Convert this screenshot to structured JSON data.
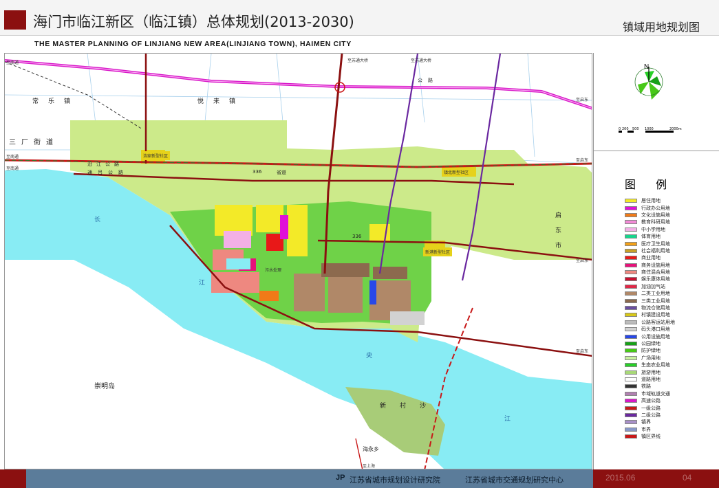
{
  "header": {
    "title": "海门市临江新区（临江镇）总体规划(2013-2030)",
    "sheet_title": "镇域用地规划图",
    "subtitle": "THE  MASTER  PLANNING OF  LINJIANG  NEW  AREA(LINJIANG  TOWN),  HAIMEN CITY"
  },
  "map": {
    "compass_north": "N",
    "scale_labels": [
      "0",
      "200",
      "500",
      "1000",
      "2000m"
    ],
    "places": {
      "changle": "常乐镇",
      "yuelai": "悦来镇",
      "sanchang": "三厂街道",
      "qidong": "启东市",
      "chongming": "崇明岛",
      "haiyong": "海永乡",
      "xincunsha": "新村沙"
    },
    "water": {
      "chang": "长",
      "jiang1": "江",
      "yang": "央",
      "jiang2": "江"
    },
    "roads": {
      "shengdao336": "336",
      "shengdao_label": "省道",
      "yanjiang": "沿江公路",
      "gonglu": "公路",
      "tonglu": "通吕公路"
    },
    "communities": {
      "haojia": "浩家新型社区",
      "qiaoqian": "镇北新型社区",
      "xincheng": "新港新型社区"
    },
    "small_text": {
      "west_edge1": "至南通",
      "west_edge2": "至南通",
      "west_edge3": "至南通",
      "east_edge1": "至启东",
      "east_edge2": "至启东",
      "east_edge3": "至启东",
      "east_edge4": "至启东",
      "north1": "至苏通大桥",
      "north2": "至苏通大桥",
      "hub": "污水处理",
      "south": "至上海"
    }
  },
  "legend": {
    "title": "图 例",
    "items": [
      {
        "label": "居住用地",
        "color": "#f3ea28"
      },
      {
        "label": "行政办公用地",
        "color": "#e010d8"
      },
      {
        "label": "文化设施用地",
        "color": "#f07a18"
      },
      {
        "label": "教育科研用地",
        "color": "#f28ad6"
      },
      {
        "label": "中小学用地",
        "color": "#f3b0e6"
      },
      {
        "label": "体育用地",
        "color": "#18d48c"
      },
      {
        "label": "医疗卫生用地",
        "color": "#f2a018"
      },
      {
        "label": "社会福利用地",
        "color": "#c8a028"
      },
      {
        "label": "商业用地",
        "color": "#e81818"
      },
      {
        "label": "商务设施用地",
        "color": "#e8107a"
      },
      {
        "label": "商住混合用地",
        "color": "#ee8880"
      },
      {
        "label": "娱乐康体用地",
        "color": "#c81030"
      },
      {
        "label": "加油加气站",
        "color": "#e02848"
      },
      {
        "label": "二类工业用地",
        "color": "#b08868"
      },
      {
        "label": "三类工业用地",
        "color": "#8c6a4e"
      },
      {
        "label": "物流仓储用地",
        "color": "#6a4ea0"
      },
      {
        "label": "村镇建设用地",
        "color": "#d8c818"
      },
      {
        "label": "公路客运站用地",
        "color": "#bcbcbc"
      },
      {
        "label": "码头港口用地",
        "color": "#d2d2d2"
      },
      {
        "label": "公用设施用地",
        "color": "#2848e8"
      },
      {
        "label": "公园绿地",
        "color": "#18a018"
      },
      {
        "label": "防护绿地",
        "color": "#48c818"
      },
      {
        "label": "广场用地",
        "color": "#c8f0a0"
      },
      {
        "label": "生态农业用地",
        "color": "#28d028"
      },
      {
        "label": "旅游用地",
        "color": "#a8d878"
      },
      {
        "label": "道路用地",
        "color": "#ffffff"
      },
      {
        "label": "铁路",
        "color": "#333333"
      },
      {
        "label": "市域轨道交通",
        "color": "#b080b0"
      },
      {
        "label": "高速公路",
        "color": "#d818c8"
      },
      {
        "label": "一级公路",
        "color": "#c81818"
      },
      {
        "label": "二级公路",
        "color": "#6a28a0"
      },
      {
        "label": "镇界",
        "color": "#a890c8"
      },
      {
        "label": "市界",
        "color": "#8898c8"
      },
      {
        "label": "镇区界线",
        "color": "#c81818"
      }
    ]
  },
  "footer": {
    "logo": "JP",
    "org1": "江苏省城市规划设计研究院",
    "org2": "江苏省城市交通规划研究中心",
    "date": "2015.06",
    "page": "04"
  }
}
